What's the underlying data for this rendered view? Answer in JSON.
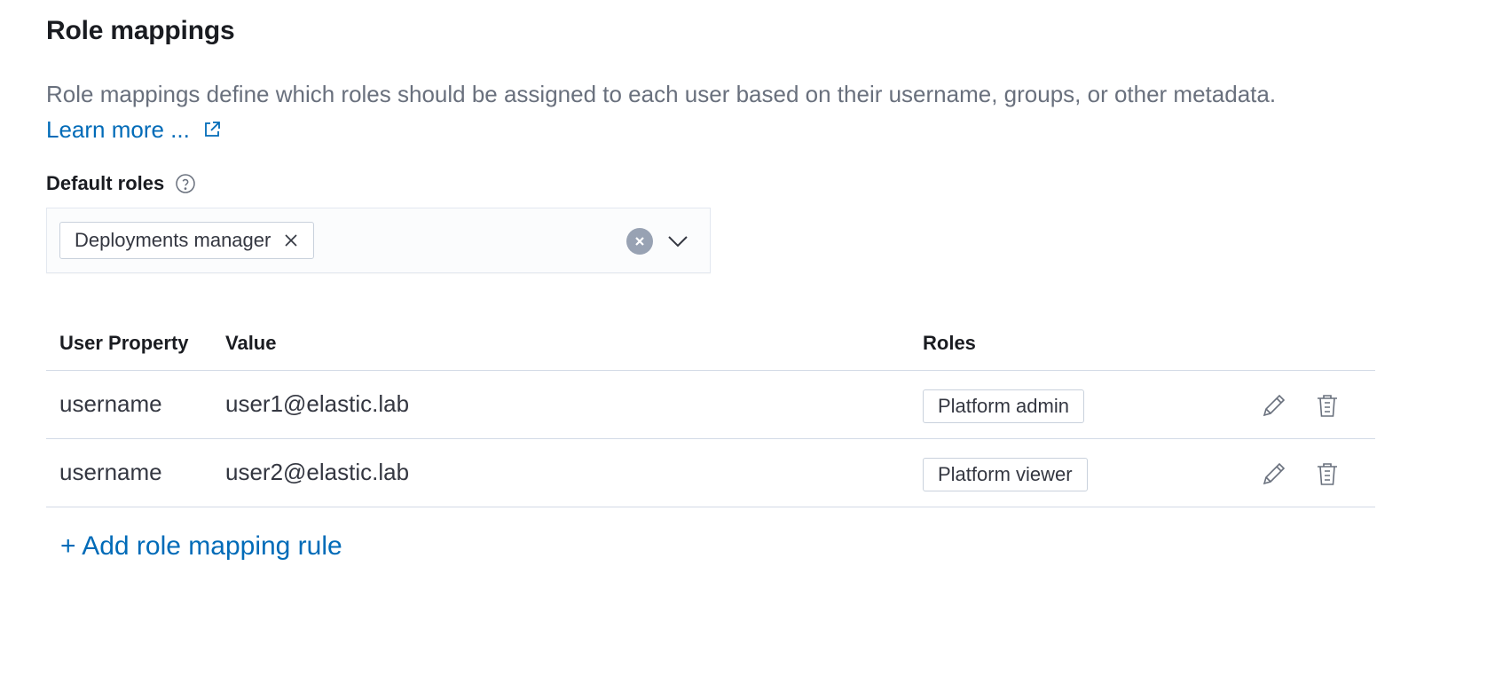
{
  "header": {
    "title": "Role mappings"
  },
  "intro": {
    "description": "Role mappings define which roles should be assigned to each user based on their username, groups, or other metadata.",
    "learn_more_label": "Learn more ..."
  },
  "default_roles": {
    "label": "Default roles",
    "selected": [
      "Deployments manager"
    ]
  },
  "table": {
    "columns": [
      "User Property",
      "Value",
      "Roles"
    ],
    "rows": [
      {
        "property": "username",
        "value": "user1@elastic.lab",
        "role": "Platform admin"
      },
      {
        "property": "username",
        "value": "user2@elastic.lab",
        "role": "Platform viewer"
      }
    ]
  },
  "add_rule_label": "+ Add role mapping rule",
  "icons": {
    "external_link": "external-link-icon",
    "help": "question-circle-icon",
    "chip_remove": "cross-icon",
    "clear": "clear-circle-icon",
    "dropdown": "chevron-down-icon",
    "edit": "pencil-icon",
    "delete": "trash-icon"
  },
  "colors": {
    "link": "#006bb8",
    "text": "#1a1c21",
    "subdued_text": "#69707d",
    "border": "#d3dae6"
  }
}
